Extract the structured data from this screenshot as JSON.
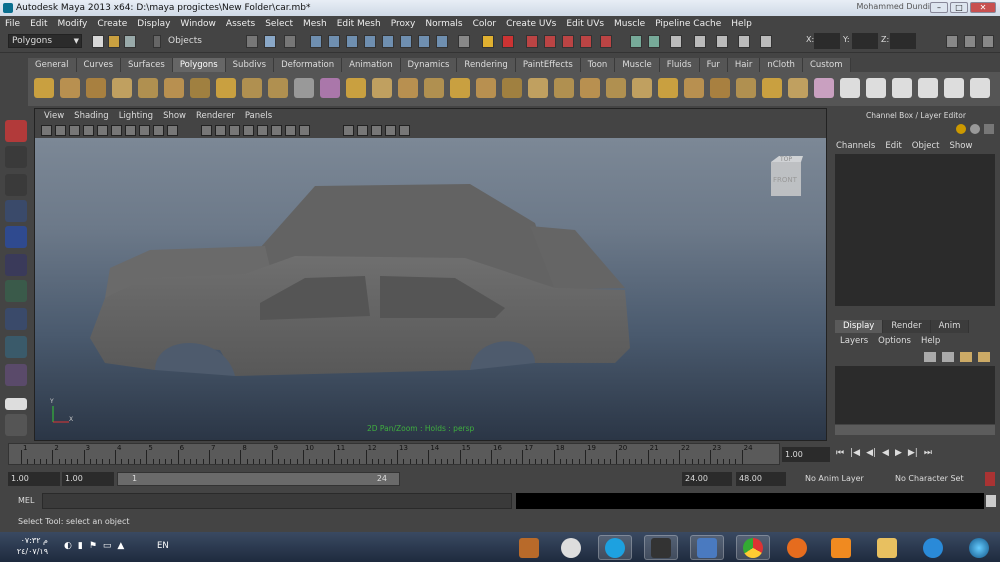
{
  "window": {
    "title": "Autodesk Maya 2013 x64: D:\\maya progictes\\New Folder\\car.mb*",
    "user": "Mohammed Dundi"
  },
  "menubar": [
    "File",
    "Edit",
    "Modify",
    "Create",
    "Display",
    "Window",
    "Assets",
    "Select",
    "Mesh",
    "Edit Mesh",
    "Proxy",
    "Normals",
    "Color",
    "Create UVs",
    "Edit UVs",
    "Muscle",
    "Pipeline Cache",
    "Help"
  ],
  "statusline": {
    "mode": "Polygons",
    "selection_label": "Objects",
    "coord_x": "X:",
    "coord_y": "Y:",
    "coord_z": "Z:"
  },
  "shelf_tabs": [
    "General",
    "Curves",
    "Surfaces",
    "Polygons",
    "Subdivs",
    "Deformation",
    "Animation",
    "Dynamics",
    "Rendering",
    "PaintEffects",
    "Toon",
    "Muscle",
    "Fluids",
    "Fur",
    "Hair",
    "nCloth",
    "Custom"
  ],
  "active_shelf_tab": "Polygons",
  "viewport": {
    "menu": [
      "View",
      "Shading",
      "Lighting",
      "Show",
      "Renderer",
      "Panels"
    ],
    "hud_label": "2D Pan/Zoom : Holds : persp",
    "viewcube_top": "TOP",
    "viewcube_front": "FRONT",
    "axis_y": "Y",
    "axis_x": "X",
    "car_color": "#6e6e6e"
  },
  "channel_box": {
    "title": "Channel Box / Layer Editor",
    "menu": [
      "Channels",
      "Edit",
      "Object",
      "Show"
    ]
  },
  "layer_editor": {
    "tabs": [
      "Display",
      "Render",
      "Anim"
    ],
    "active_tab": "Display",
    "menu": [
      "Layers",
      "Options",
      "Help"
    ]
  },
  "timeline": {
    "ticks": [
      "1",
      "2",
      "3",
      "4",
      "5",
      "6",
      "7",
      "8",
      "9",
      "10",
      "11",
      "12",
      "13",
      "14",
      "15",
      "16",
      "17",
      "18",
      "19",
      "20",
      "21",
      "22",
      "23",
      "24"
    ],
    "current_frame": "1.00"
  },
  "range": {
    "start": "1.00",
    "playback_start": "1.00",
    "slider_start": "1",
    "slider_end": "24",
    "playback_end": "24.00",
    "end": "48.00",
    "anim_layer": "No Anim Layer",
    "character_set": "No Character Set"
  },
  "mel": {
    "label": "MEL"
  },
  "helpline": "Select Tool: select an object",
  "taskbar": {
    "time": "م ٠٧:٣٢",
    "date": "٢٤/٠٧/١٩",
    "language": "EN"
  }
}
